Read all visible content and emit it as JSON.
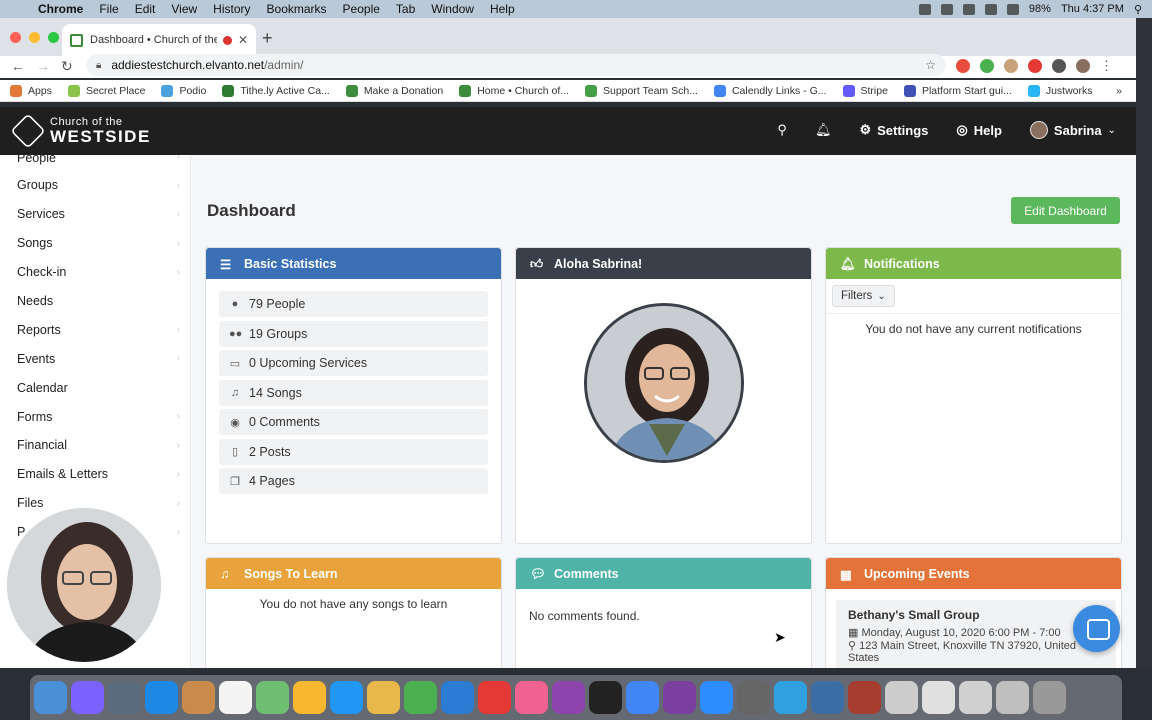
{
  "menubar": {
    "app": "Chrome",
    "items": [
      "File",
      "Edit",
      "View",
      "History",
      "Bookmarks",
      "People",
      "Tab",
      "Window",
      "Help"
    ],
    "battery": "98%",
    "clock": "Thu 4:37 PM"
  },
  "browser": {
    "tab_title": "Dashboard • Church of the",
    "url_host": "addiestestchurch.elvanto.net",
    "url_path": "/admin/",
    "bookmarks": [
      {
        "label": "Apps",
        "color": "#e07b39"
      },
      {
        "label": "Secret Place",
        "color": "#8bc34a"
      },
      {
        "label": "Podio",
        "color": "#4aa3df"
      },
      {
        "label": "Tithe.ly Active Ca...",
        "color": "#2e7d32"
      },
      {
        "label": "Make a Donation",
        "color": "#3c8c3c"
      },
      {
        "label": "Home • Church of...",
        "color": "#3c8c3c"
      },
      {
        "label": "Support Team Sch...",
        "color": "#43a047"
      },
      {
        "label": "Calendly Links - G...",
        "color": "#4285f4"
      },
      {
        "label": "Stripe",
        "color": "#635bff"
      },
      {
        "label": "Platform Start gui...",
        "color": "#3f51b5"
      },
      {
        "label": "Justworks",
        "color": "#29b6f6"
      }
    ],
    "bookmarks_more": "»"
  },
  "header": {
    "logo_top": "Church of the",
    "logo_bottom": "WESTSIDE",
    "settings_label": "Settings",
    "help_label": "Help",
    "user_name": "Sabrina"
  },
  "sidebar": {
    "items": [
      {
        "label": "People",
        "chevron": true
      },
      {
        "label": "Groups",
        "chevron": true
      },
      {
        "label": "Services",
        "chevron": true
      },
      {
        "label": "Songs",
        "chevron": true
      },
      {
        "label": "Check-in",
        "chevron": true
      },
      {
        "label": "Needs",
        "chevron": false
      },
      {
        "label": "Reports",
        "chevron": true
      },
      {
        "label": "Events",
        "chevron": true
      },
      {
        "label": "Calendar",
        "chevron": false
      },
      {
        "label": "Forms",
        "chevron": true
      },
      {
        "label": "Financial",
        "chevron": true
      },
      {
        "label": "Emails & Letters",
        "chevron": true
      },
      {
        "label": "Files",
        "chevron": true
      },
      {
        "label": "P",
        "chevron": true
      }
    ]
  },
  "main": {
    "title": "Dashboard",
    "edit_button": "Edit Dashboard",
    "basic_stats": {
      "title": "Basic Statistics",
      "color": "#3b6fb6",
      "items": [
        {
          "icon": "person-icon",
          "label": "79 People"
        },
        {
          "icon": "group-icon",
          "label": "19 Groups"
        },
        {
          "icon": "calendar-icon",
          "label": "0 Upcoming Services"
        },
        {
          "icon": "music-note-icon",
          "label": "14 Songs"
        },
        {
          "icon": "comment-icon",
          "label": "0 Comments"
        },
        {
          "icon": "file-icon",
          "label": "2 Posts"
        },
        {
          "icon": "pages-icon",
          "label": "4 Pages"
        }
      ]
    },
    "greeting": {
      "title": "Aloha Sabrina!",
      "color": "#3a4049"
    },
    "notifications": {
      "title": "Notifications",
      "color": "#7cb84a",
      "filters_label": "Filters",
      "empty": "You do not have any current notifications"
    },
    "songs_to_learn": {
      "title": "Songs To Learn",
      "color": "#e8a33d",
      "empty": "You do not have any songs to learn"
    },
    "comments": {
      "title": "Comments",
      "color": "#4fb3a8",
      "empty": "No comments found."
    },
    "upcoming_events": {
      "title": "Upcoming Events",
      "color": "#e4733a",
      "event_name": "Bethany's Small Group",
      "event_date": "Monday, August 10, 2020 6:00 PM - 7:00",
      "event_address": "123 Main Street, Knoxville TN 37920, United States"
    }
  },
  "dock": {
    "app_colors": [
      "#4a90d9",
      "#7b61ff",
      "#5a6b7d",
      "#1e88e5",
      "#c98a4b",
      "#f4f4f4",
      "#6fbf73",
      "#f7b731",
      "#2196f3",
      "#e8b84a",
      "#4caf50",
      "#2b7cd3",
      "#e53935",
      "#f06292",
      "#8e44ad",
      "#222222",
      "#4285f4",
      "#7b3fa0",
      "#2d8cff",
      "#666666",
      "#2fa0e0",
      "#3a6ea5",
      "#a63d2f",
      "#cccccc",
      "#e0e0e0",
      "#d0d0d0",
      "#bfbfbf",
      "#999999"
    ]
  }
}
